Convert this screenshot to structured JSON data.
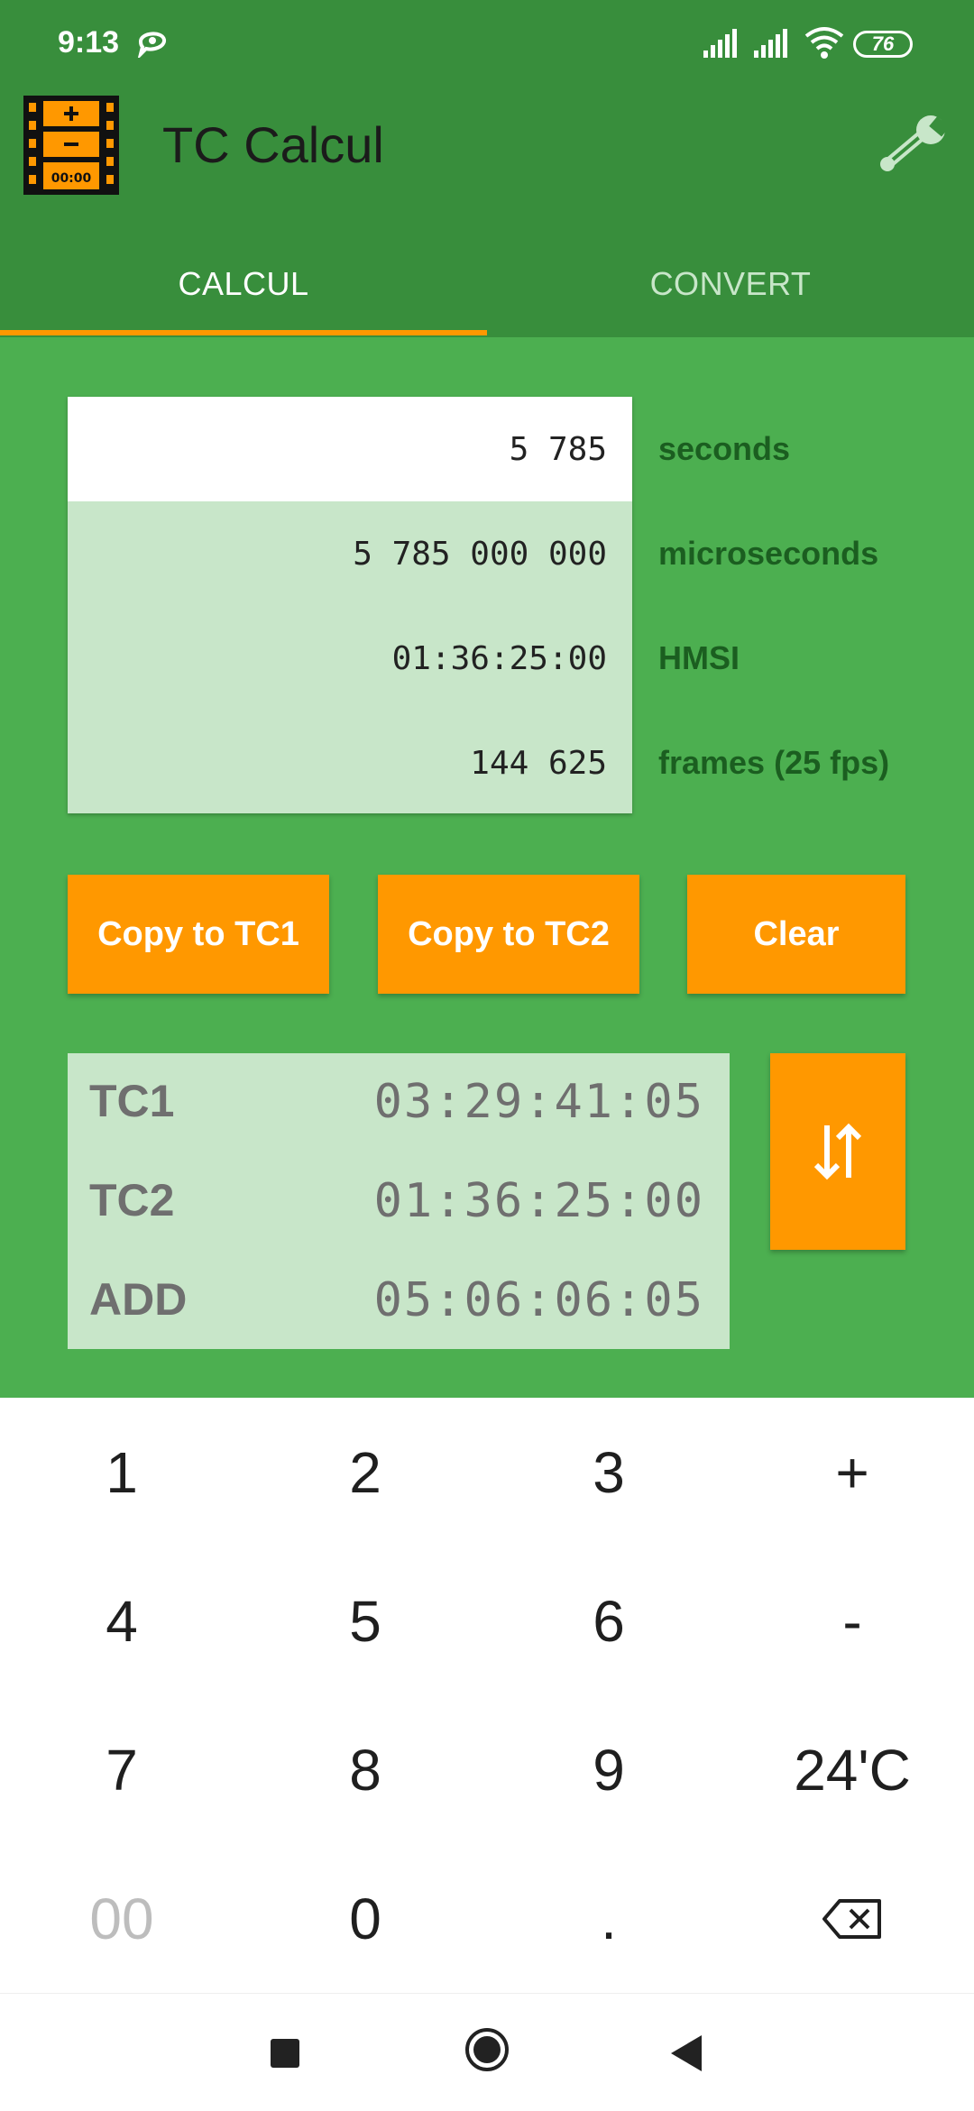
{
  "status_bar": {
    "time": "9:13",
    "battery": "76"
  },
  "app": {
    "title": "TC Calcul"
  },
  "tabs": [
    {
      "label": "CALCUL"
    },
    {
      "label": "CONVERT"
    }
  ],
  "conversion": {
    "rows": [
      {
        "value": "5 785",
        "unit": "seconds"
      },
      {
        "value": "5 785 000 000",
        "unit": "microseconds"
      },
      {
        "value": "01:36:25:00",
        "unit": "HMSI"
      },
      {
        "value": "144 625",
        "unit": "frames (25 fps)"
      }
    ]
  },
  "actions": {
    "copy_tc1": "Copy to TC1",
    "copy_tc2": "Copy to TC2",
    "clear": "Clear"
  },
  "timecodes": [
    {
      "label": "TC1",
      "value": "03:29:41:05"
    },
    {
      "label": "TC2",
      "value": "01:36:25:00"
    },
    {
      "label": "ADD",
      "value": "05:06:06:05"
    }
  ],
  "keypad": {
    "keys": [
      "1",
      "2",
      "3",
      "+",
      "4",
      "5",
      "6",
      "-",
      "7",
      "8",
      "9",
      "24'C",
      "00",
      "0",
      ".",
      "backspace"
    ]
  },
  "colors": {
    "primary": "#4caf50",
    "primary_dark": "#388e3c",
    "accent": "#ff9800",
    "card": "#c8e6c9"
  }
}
